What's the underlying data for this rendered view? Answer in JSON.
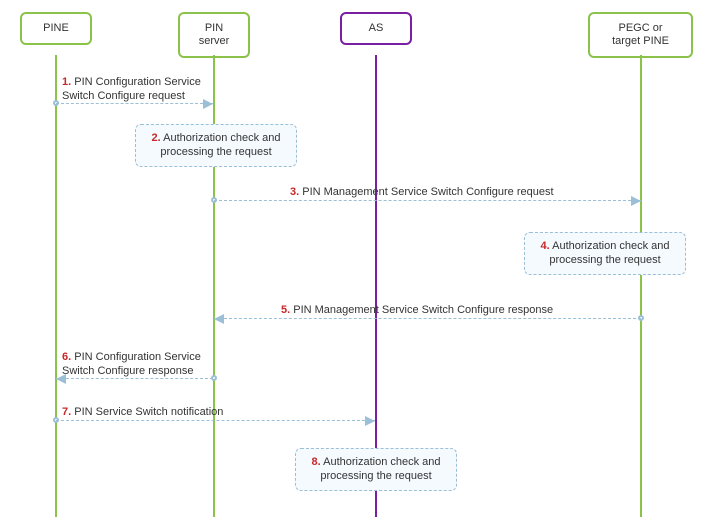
{
  "participants": {
    "pine": "PINE",
    "pin_server": "PIN\nserver",
    "as": "AS",
    "pegc": "PEGC or\ntarget PINE"
  },
  "steps": {
    "s1": {
      "num": "1.",
      "label": "PIN Configuration Service\nSwitch Configure request"
    },
    "s2": {
      "num": "2.",
      "label": "Authorization check and\nprocessing the request"
    },
    "s3": {
      "num": "3.",
      "label": "PIN Management Service Switch Configure request"
    },
    "s4": {
      "num": "4.",
      "label": "Authorization check and\nprocessing the request"
    },
    "s5": {
      "num": "5.",
      "label": "PIN Management Service Switch Configure response"
    },
    "s6": {
      "num": "6.",
      "label": "PIN Configuration Service\nSwitch Configure response"
    },
    "s7": {
      "num": "7.",
      "label": "PIN Service Switch notification"
    },
    "s8": {
      "num": "8.",
      "label": "Authorization check and\nprocessing the request"
    }
  },
  "chart_data": {
    "type": "sequence-diagram",
    "participants": [
      "PINE",
      "PIN server",
      "AS",
      "PEGC or target PINE"
    ],
    "messages": [
      {
        "step": 1,
        "from": "PINE",
        "to": "PIN server",
        "text": "PIN Configuration Service Switch Configure request",
        "kind": "message"
      },
      {
        "step": 2,
        "at": "PIN server",
        "text": "Authorization check and processing the request",
        "kind": "process"
      },
      {
        "step": 3,
        "from": "PIN server",
        "to": "PEGC or target PINE",
        "text": "PIN Management Service Switch Configure request",
        "kind": "message"
      },
      {
        "step": 4,
        "at": "PEGC or target PINE",
        "text": "Authorization check and processing the request",
        "kind": "process"
      },
      {
        "step": 5,
        "from": "PEGC or target PINE",
        "to": "PIN server",
        "text": "PIN Management Service Switch Configure response",
        "kind": "message"
      },
      {
        "step": 6,
        "from": "PIN server",
        "to": "PINE",
        "text": "PIN Configuration Service Switch Configure response",
        "kind": "message"
      },
      {
        "step": 7,
        "from": "PINE",
        "to": "AS",
        "text": "PIN Service Switch notification",
        "kind": "message"
      },
      {
        "step": 8,
        "at": "AS",
        "text": "Authorization check and processing the request",
        "kind": "process"
      }
    ]
  }
}
